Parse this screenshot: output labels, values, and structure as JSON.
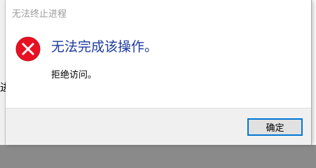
{
  "dialog": {
    "title": "无法终止进程",
    "main_instruction": "无法完成该操作。",
    "content": "拒绝访问。",
    "ok_label": "确定",
    "icon": "error-icon",
    "colors": {
      "instruction": "#1c3a9e",
      "icon_fill": "#e81123",
      "button_border": "#0078d7"
    }
  },
  "backdrop": {
    "partial_char": "进"
  }
}
